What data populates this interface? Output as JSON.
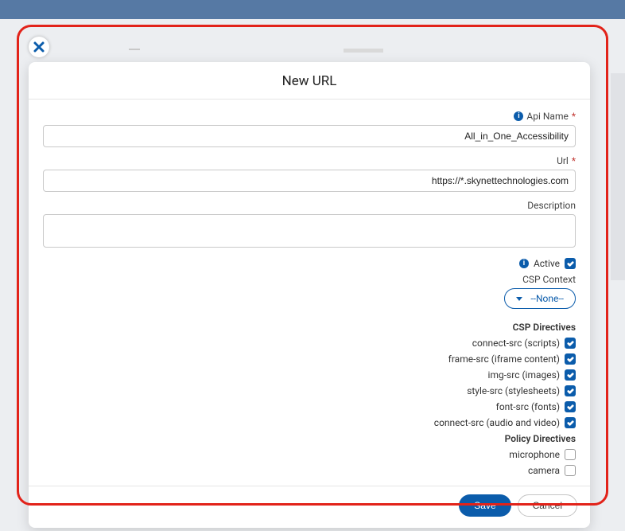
{
  "modal": {
    "title": "New URL",
    "fields": {
      "apiName": {
        "label": "Api Name",
        "value": "All_in_One_Accessibility"
      },
      "url": {
        "label": "Url",
        "value": "https://*.skynettechnologies.com"
      },
      "description": {
        "label": "Description",
        "value": ""
      },
      "active": {
        "label": "Active"
      },
      "cspContextLabel": "CSP Context",
      "cspContextValue": "--None--"
    },
    "cspSectionTitle": "CSP Directives",
    "cspDirectives": [
      {
        "label": "connect-src (scripts)",
        "checked": true
      },
      {
        "label": "frame-src (iframe content)",
        "checked": true
      },
      {
        "label": "img-src (images)",
        "checked": true
      },
      {
        "label": "style-src (stylesheets)",
        "checked": true
      },
      {
        "label": "font-src (fonts)",
        "checked": true
      },
      {
        "label": "connect-src (audio and video)",
        "checked": true
      }
    ],
    "policySectionTitle": "Policy Directives",
    "policyDirectives": [
      {
        "label": "microphone",
        "checked": false
      },
      {
        "label": "camera",
        "checked": false
      }
    ],
    "buttons": {
      "cancel": "Cancel",
      "save": "Save"
    }
  }
}
